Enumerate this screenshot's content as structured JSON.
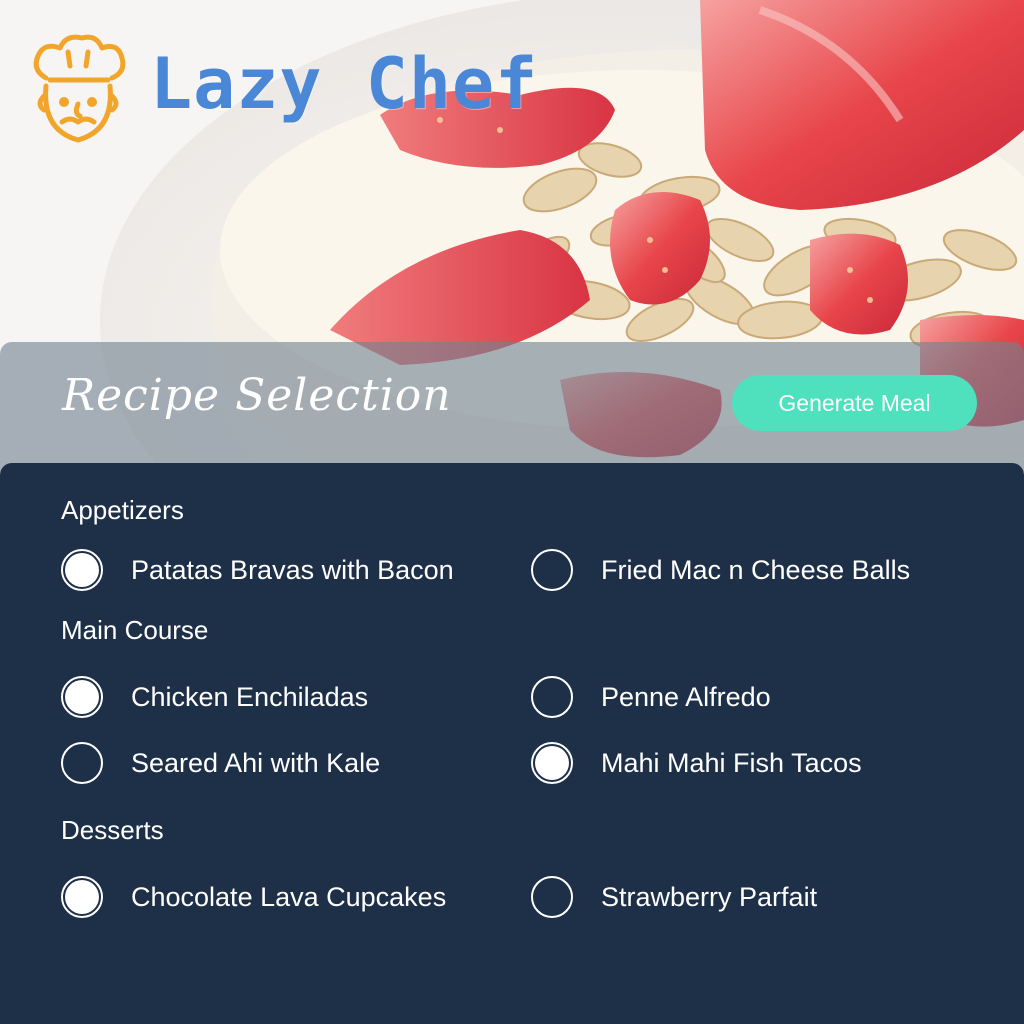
{
  "app": {
    "name": "Lazy Chef",
    "logo_icon": "chef-face-icon"
  },
  "header": {
    "title": "Recipe Selection",
    "generate_button_label": "Generate Meal"
  },
  "colors": {
    "accent": "#4fe0bd",
    "panel": "#1e2f48",
    "logo_text": "#4a87d6",
    "logo_icon": "#f2a52b"
  },
  "groups": [
    {
      "label": "Appetizers",
      "options": [
        {
          "label": "Patatas Bravas with Bacon",
          "selected": true
        },
        {
          "label": "Fried Mac n Cheese Balls",
          "selected": false
        }
      ]
    },
    {
      "label": "Main Course",
      "options": [
        {
          "label": "Chicken Enchiladas",
          "selected": true
        },
        {
          "label": "Penne Alfredo",
          "selected": false
        },
        {
          "label": "Seared Ahi with Kale",
          "selected": false
        },
        {
          "label": "Mahi Mahi Fish Tacos",
          "selected": true
        }
      ]
    },
    {
      "label": "Desserts",
      "options": [
        {
          "label": "Chocolate Lava Cupcakes",
          "selected": true
        },
        {
          "label": "Strawberry Parfait",
          "selected": false
        }
      ]
    }
  ]
}
